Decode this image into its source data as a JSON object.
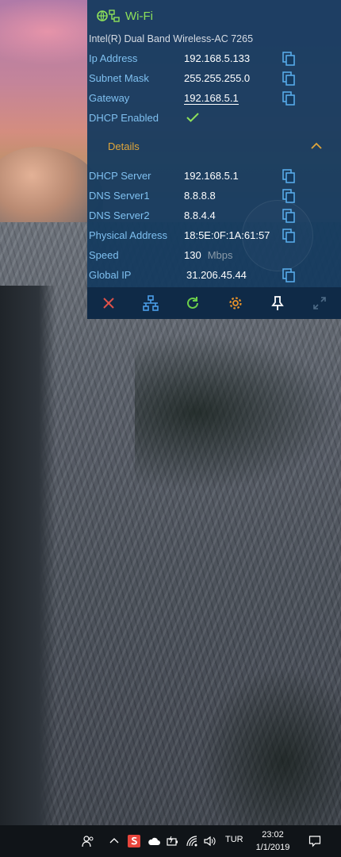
{
  "panel": {
    "title": "Wi-Fi",
    "adapter": "Intel(R) Dual Band Wireless-AC 7265",
    "rows_top": [
      {
        "label": "Ip Address",
        "value": "192.168.5.133"
      },
      {
        "label": "Subnet Mask",
        "value": "255.255.255.0"
      },
      {
        "label": "Gateway",
        "value": "192.168.5.1"
      }
    ],
    "dhcp_label": "DHCP Enabled",
    "details_label": "Details",
    "rows_details": [
      {
        "label": "DHCP Server",
        "value": "192.168.5.1"
      },
      {
        "label": "DNS Server1",
        "value": "8.8.8.8"
      },
      {
        "label": "DNS Server2",
        "value": "8.8.4.4"
      },
      {
        "label": "Physical Address",
        "value": "18:5E:0F:1A:61:57"
      }
    ],
    "speed_label": "Speed",
    "speed_value": "130",
    "speed_unit": "Mbps",
    "global_ip_label": "Global IP",
    "global_ip_value": "31.206.45.44"
  },
  "toolbar": {
    "icons": [
      "close-icon",
      "network-icon",
      "refresh-icon",
      "settings-icon",
      "pin-icon",
      "expand-icon"
    ]
  },
  "taskbar": {
    "language": "TUR",
    "time": "23:02",
    "date": "1/1/2019"
  },
  "colors": {
    "accent_green": "#8de05a",
    "label_blue": "#7fc0f0",
    "details_orange": "#e0a63a",
    "close_red": "#e0524a",
    "settings_orange": "#e8922a"
  }
}
